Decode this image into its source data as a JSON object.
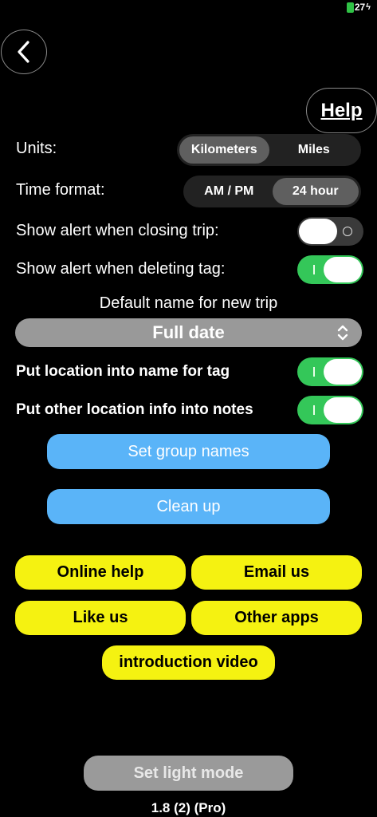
{
  "status": {
    "battery": "27"
  },
  "header": {
    "help_label": "Help"
  },
  "settings": {
    "units": {
      "label": "Units:",
      "options": [
        "Kilometers",
        "Miles"
      ],
      "selected": "Kilometers"
    },
    "time_format": {
      "label": "Time format:",
      "options": [
        "AM / PM",
        "24 hour"
      ],
      "selected": "24 hour"
    },
    "alert_closing_trip": {
      "label": "Show alert when closing trip:",
      "on": false
    },
    "alert_deleting_tag": {
      "label": "Show alert when deleting tag:",
      "on": true
    },
    "default_name": {
      "label": "Default name for new trip",
      "value": "Full date"
    },
    "location_in_tag_name": {
      "label": "Put location into name for tag",
      "on": true
    },
    "location_in_notes": {
      "label": "Put other location info into notes",
      "on": true
    }
  },
  "actions": {
    "set_group_names": "Set group names",
    "clean_up": "Clean up"
  },
  "links": {
    "online_help": "Online help",
    "email_us": "Email us",
    "like_us": "Like us",
    "other_apps": "Other apps",
    "intro_video": "introduction video"
  },
  "footer": {
    "light_mode": "Set light mode",
    "version": "1.8 (2)  (Pro)"
  },
  "colors": {
    "toggle_on": "#34c759",
    "blue_button": "#5ab4f8",
    "yellow_button": "#f5f211",
    "background": "#000000"
  },
  "icons": [
    "back-chevron-icon",
    "battery-charging-icon",
    "chevron-up-down-icon"
  ]
}
